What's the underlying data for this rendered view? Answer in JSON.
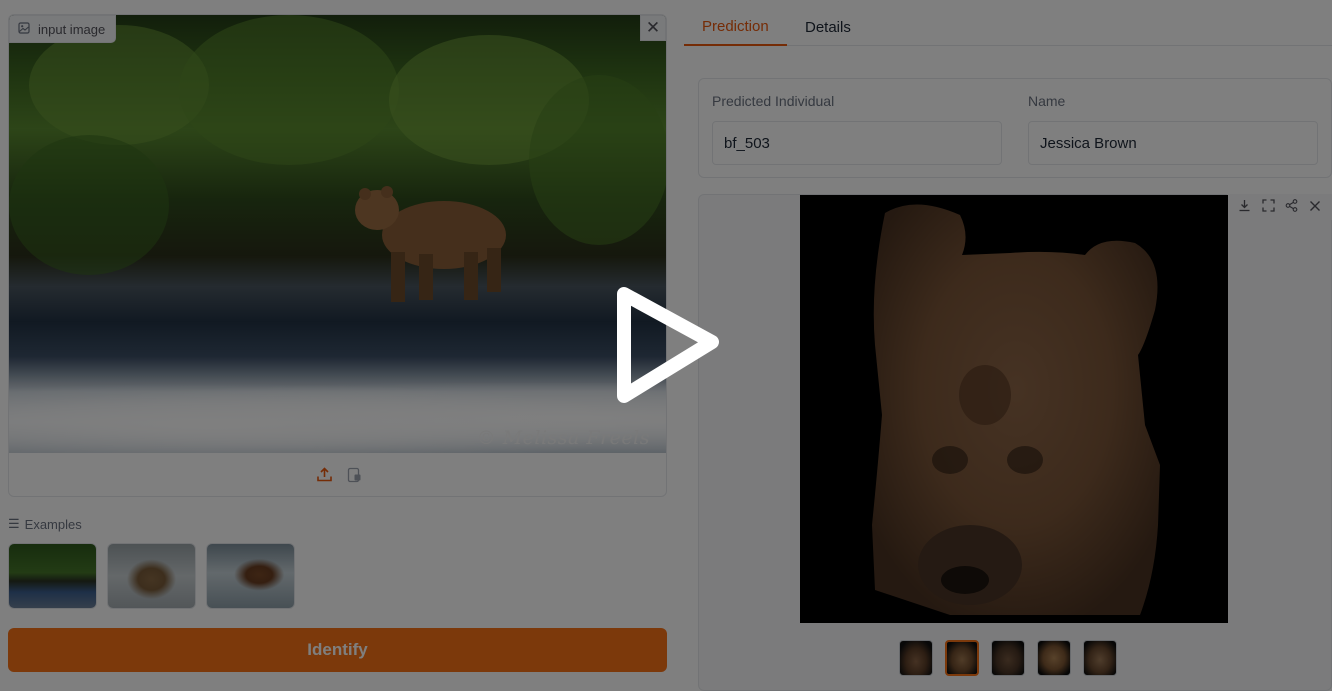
{
  "input_panel": {
    "label": "input image",
    "label_icon": "image-icon",
    "close_icon": "close-icon",
    "upload_icon": "upload-icon",
    "paste_icon": "clipboard-icon",
    "photo_watermark": "© Melissa Freels"
  },
  "examples": {
    "label": "Examples",
    "icon": "list-icon",
    "items": [
      "example-1",
      "example-2",
      "example-3"
    ]
  },
  "identify_button": {
    "label": "Identify",
    "color": "#f97316"
  },
  "tabs": [
    {
      "label": "Prediction",
      "active": true
    },
    {
      "label": "Details",
      "active": false
    }
  ],
  "fields": {
    "predicted_individual": {
      "label": "Predicted Individual",
      "value": "bf_503"
    },
    "name": {
      "label": "Name",
      "value": "Jessica Brown"
    }
  },
  "gallery": {
    "toolbar_icons": [
      "download-icon",
      "fullscreen-icon",
      "share-icon",
      "close-icon"
    ],
    "thumbnail_count": 5,
    "selected_index": 1
  },
  "overlay": {
    "play_icon": "play-icon"
  },
  "colors": {
    "accent": "#f97316",
    "tab_active": "#ea580c"
  }
}
